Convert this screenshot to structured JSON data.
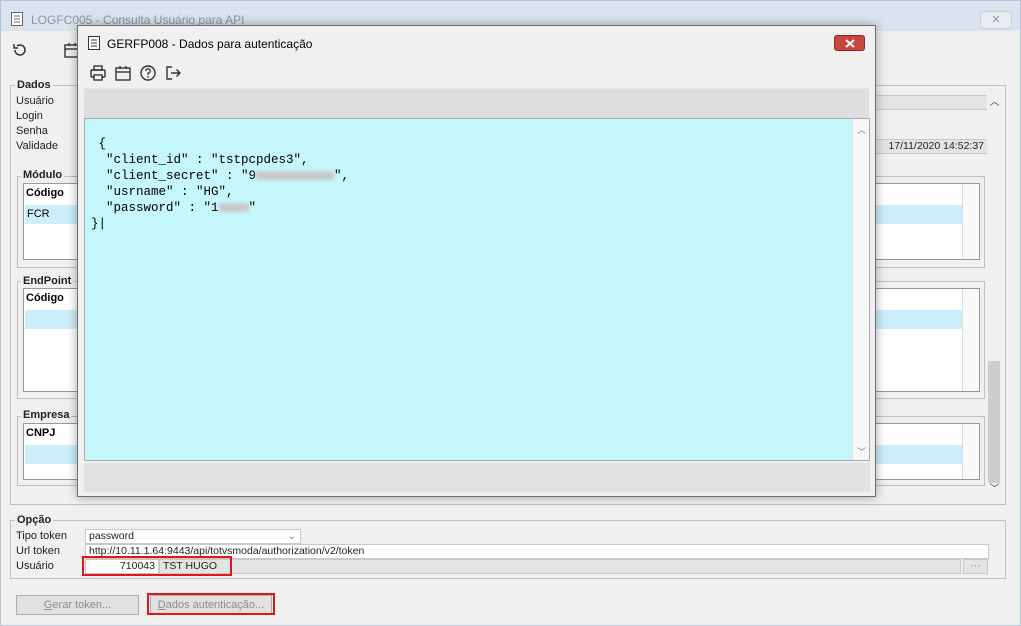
{
  "main_window": {
    "title": "LOGFC005 - Consulta Usuário para API",
    "close_label": "✕"
  },
  "dados": {
    "label": "Dados",
    "usuario_label": "Usuário",
    "login_label": "Login",
    "senha_label": "Senha",
    "validade_label": "Validade",
    "validade_value": "17/11/2020 14:52:37"
  },
  "modulo": {
    "label": "Módulo",
    "col_codigo": "Código",
    "row_value": "FCR"
  },
  "endpoint": {
    "label": "EndPoint",
    "col_codigo": "Código"
  },
  "empresa": {
    "label": "Empresa",
    "col_cnpj": "CNPJ"
  },
  "opcao": {
    "label": "Opção",
    "tipo_token_label": "Tipo token",
    "tipo_token_value": "password",
    "url_token_label": "Url token",
    "url_token_value": "http://10.11.1.64:9443/api/totvsmoda/authorization/v2/token",
    "usuario_label": "Usuário",
    "usuario_code": "710043",
    "usuario_name": "TST HUGO"
  },
  "buttons": {
    "gerar_token_prefix": "G",
    "gerar_token_rest": "erar token...",
    "dados_auth_prefix": "D",
    "dados_auth_rest": "ados autenticação..."
  },
  "dialog": {
    "title": "GERFP008 - Dados para autenticação",
    "json_open": "{",
    "line1": "\"client_id\" : \"tstpcpdes3\",",
    "line2_prefix": "\"client_secret\" : \"9",
    "line2_suffix": "\",",
    "line3": "\"usrname\" : \"HG\",",
    "line4_prefix": "\"password\" : \"1",
    "line4_suffix": "\"",
    "json_close": "}"
  },
  "icons": {
    "main_toolbar": [
      "refresh-icon",
      "calendar-icon"
    ],
    "dialog_toolbar": [
      "print-icon",
      "calendar-icon",
      "help-icon",
      "exit-icon"
    ]
  },
  "colors": {
    "selection_row": "#cdeffb",
    "text_area_bg": "#c5f6fb",
    "close_button": "#c9463d",
    "highlight_border": "#e0151d"
  }
}
